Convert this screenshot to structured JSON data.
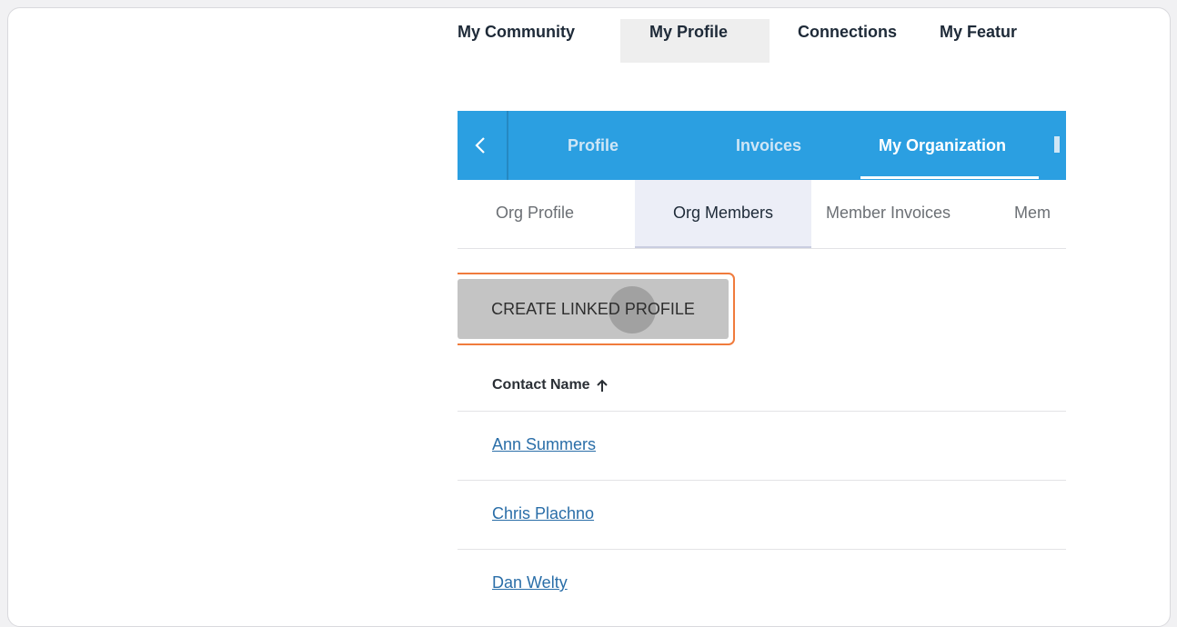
{
  "topnav": {
    "items": [
      "My Community",
      "My Profile",
      "Connections",
      "My Featur"
    ]
  },
  "tabs": {
    "items": [
      "Profile",
      "Invoices",
      "My Organization"
    ]
  },
  "subtabs": {
    "items": [
      "Org Profile",
      "Org Members",
      "Member Invoices",
      "Mem"
    ]
  },
  "button": {
    "label": "CREATE LINKED PROFILE"
  },
  "table": {
    "header": "Contact Name",
    "rows": [
      "Ann Summers",
      "Chris Plachno",
      "Dan Welty"
    ]
  },
  "colors": {
    "accent": "#2b9fe1",
    "highlight": "#f07b3c",
    "link": "#2a6ea8"
  },
  "icons": {
    "back": "chevron-left-icon",
    "sort": "arrow-up-icon"
  }
}
